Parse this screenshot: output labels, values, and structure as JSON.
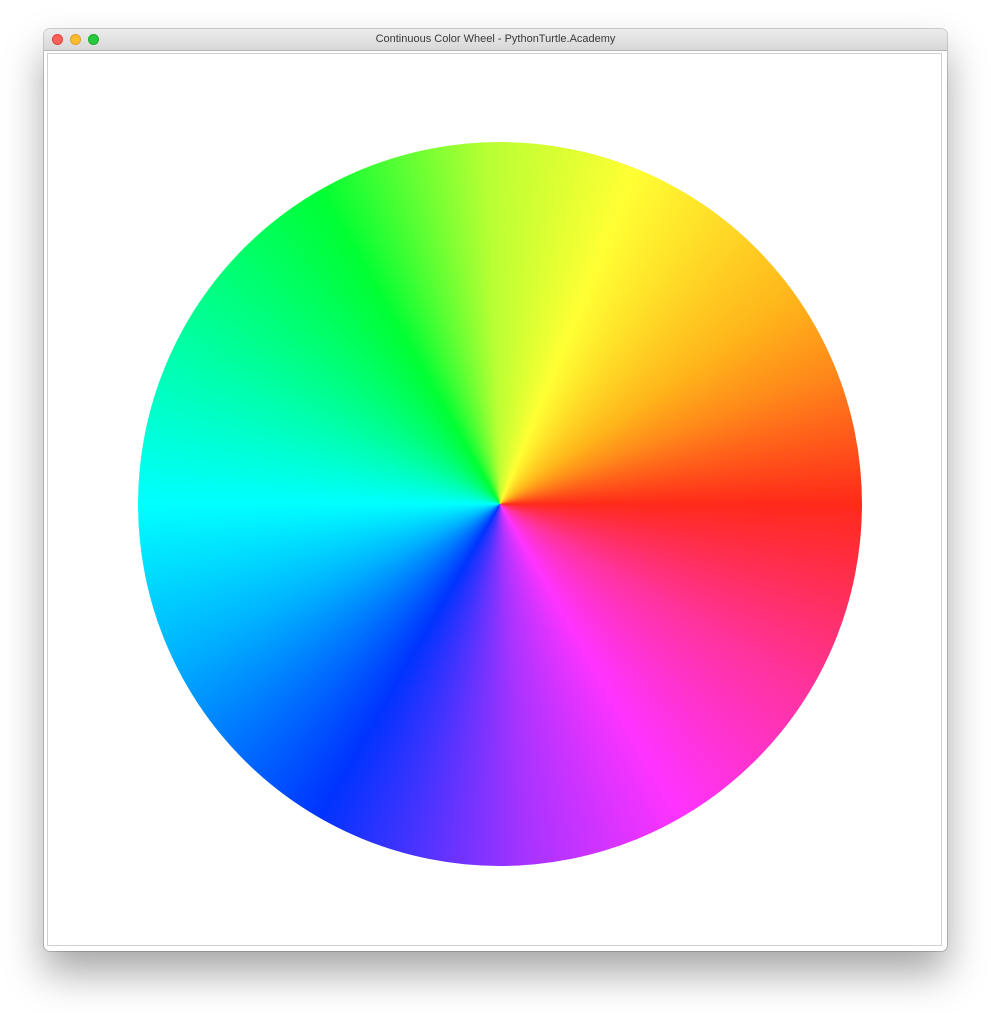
{
  "window": {
    "title": "Continuous Color Wheel - PythonTurtle.Academy"
  },
  "window_controls": {
    "close_color": "#fe5f57",
    "minimize_color": "#febc2e",
    "zoom_color": "#28c840"
  },
  "canvas": {
    "background": "#ffffff",
    "color_wheel": {
      "gradient_stops": [
        {
          "color": "#ff2a1a",
          "angle_deg": 0
        },
        {
          "color": "#ff8a1a",
          "angle_deg": 22
        },
        {
          "color": "#ffb51a",
          "angle_deg": 35
        },
        {
          "color": "#ffff33",
          "angle_deg": 68
        },
        {
          "color": "#b8ff33",
          "angle_deg": 92
        },
        {
          "color": "#00ff33",
          "angle_deg": 120
        },
        {
          "color": "#00ff99",
          "angle_deg": 150
        },
        {
          "color": "#00ffff",
          "angle_deg": 180
        },
        {
          "color": "#00b2ff",
          "angle_deg": 205
        },
        {
          "color": "#0033ff",
          "angle_deg": 240
        },
        {
          "color": "#4433ff",
          "angle_deg": 255
        },
        {
          "color": "#aa33ff",
          "angle_deg": 275
        },
        {
          "color": "#ff33ff",
          "angle_deg": 300
        },
        {
          "color": "#ff3399",
          "angle_deg": 330
        },
        {
          "color": "#ff2a1a",
          "angle_deg": 360
        }
      ]
    }
  }
}
